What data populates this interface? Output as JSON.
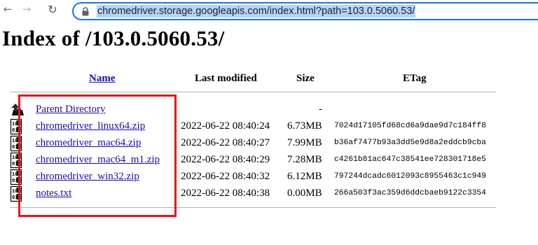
{
  "browser": {
    "back_icon": "arrow-left-icon",
    "forward_icon": "arrow-right-icon",
    "reload_icon": "reload-icon",
    "lock_icon": "lock-icon",
    "url": "chromedriver.storage.googleapis.com/index.html?path=103.0.5060.53/"
  },
  "page": {
    "title": "Index of /103.0.5060.53/"
  },
  "table": {
    "headers": {
      "name": "Name",
      "last_modified": "Last modified",
      "size": "Size",
      "etag": "ETag"
    },
    "rows": [
      {
        "name": "Parent Directory",
        "date": "",
        "size": "-",
        "etag": "",
        "icon": "parent-directory-icon"
      },
      {
        "name": "chromedriver_linux64.zip",
        "date": "2022-06-22 08:40:24",
        "size": "6.73MB",
        "etag": "7024d17105fd68cd6a9dae9d7c184ff8",
        "icon": "binary-file-icon"
      },
      {
        "name": "chromedriver_mac64.zip",
        "date": "2022-06-22 08:40:27",
        "size": "7.99MB",
        "etag": "b36af7477b93a3dd5e9d8a2eddcb9cba",
        "icon": "binary-file-icon"
      },
      {
        "name": "chromedriver_mac64_m1.zip",
        "date": "2022-06-22 08:40:29",
        "size": "7.28MB",
        "etag": "c4261b81ac647c38541ee728301718e5",
        "icon": "binary-file-icon"
      },
      {
        "name": "chromedriver_win32.zip",
        "date": "2022-06-22 08:40:32",
        "size": "6.12MB",
        "etag": "797244dcadc6012093c8955463c1c949",
        "icon": "binary-file-icon"
      },
      {
        "name": "notes.txt",
        "date": "2022-06-22 08:40:38",
        "size": "0.00MB",
        "etag": "266a503f3ac359d6ddcbaeb9122c3354",
        "icon": "binary-file-icon"
      }
    ]
  },
  "colors": {
    "link": "#1a0dab",
    "highlight_border": "#e8141a",
    "url_selection": "#b5d5ff",
    "omnibox_focus": "#1a73e8"
  }
}
